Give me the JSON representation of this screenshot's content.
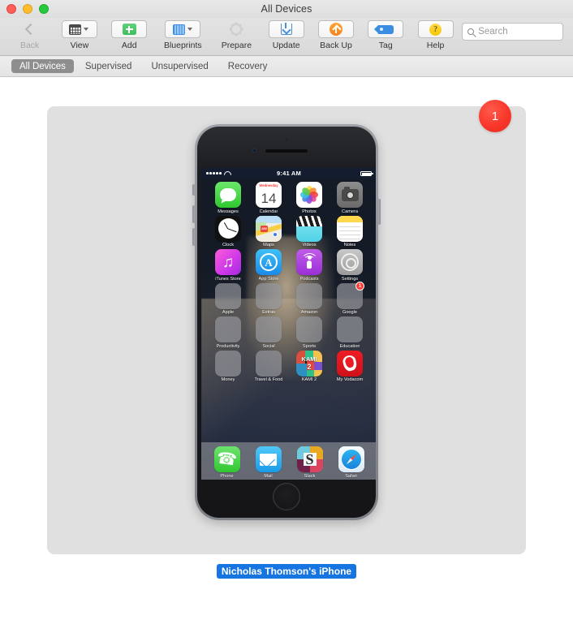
{
  "window": {
    "title": "All Devices",
    "traffic_lights": [
      "close",
      "minimize",
      "maximize"
    ]
  },
  "toolbar": {
    "items": [
      {
        "label": "Back",
        "icon": "back-chevron-icon",
        "enabled": false,
        "has_menu": false
      },
      {
        "label": "View",
        "icon": "grid-view-icon",
        "enabled": true,
        "has_menu": true
      },
      {
        "label": "Add",
        "icon": "plus-icon",
        "enabled": true,
        "has_menu": false
      },
      {
        "label": "Blueprints",
        "icon": "blueprint-grid-icon",
        "enabled": true,
        "has_menu": true
      },
      {
        "label": "Prepare",
        "icon": "gear-icon",
        "enabled": false,
        "has_menu": false
      },
      {
        "label": "Update",
        "icon": "download-icon",
        "enabled": true,
        "has_menu": false
      },
      {
        "label": "Back Up",
        "icon": "up-arrow-circle-icon",
        "enabled": true,
        "has_menu": false
      },
      {
        "label": "Tag",
        "icon": "tag-icon",
        "enabled": true,
        "has_menu": false
      },
      {
        "label": "Help",
        "icon": "question-circle-icon",
        "enabled": true,
        "has_menu": false
      }
    ],
    "search": {
      "placeholder": "Search",
      "value": "",
      "icon": "search-icon"
    }
  },
  "tabs": [
    {
      "label": "All Devices",
      "active": true
    },
    {
      "label": "Supervised",
      "active": false
    },
    {
      "label": "Unsupervised",
      "active": false
    },
    {
      "label": "Recovery",
      "active": false
    }
  ],
  "device_card": {
    "badge": "1",
    "device_name": "Nicholas Thomson's iPhone",
    "selected": true,
    "device_type": "iPhone",
    "device_color": "Space Gray"
  },
  "phone_screen": {
    "status_bar": {
      "signal_dots": 5,
      "wifi": "wifi-icon",
      "time": "9:41 AM",
      "battery": "battery-full-icon"
    },
    "calendar_weekday": "Wednesday",
    "calendar_day": "14",
    "home_rows": [
      [
        {
          "name": "Messages",
          "kind": "app",
          "badge": null
        },
        {
          "name": "Calendar",
          "kind": "app",
          "badge": null
        },
        {
          "name": "Photos",
          "kind": "app",
          "badge": null
        },
        {
          "name": "Camera",
          "kind": "app",
          "badge": null
        }
      ],
      [
        {
          "name": "Clock",
          "kind": "app",
          "badge": null
        },
        {
          "name": "Maps",
          "kind": "app",
          "badge": null
        },
        {
          "name": "Videos",
          "kind": "app",
          "badge": null
        },
        {
          "name": "Notes",
          "kind": "app",
          "badge": null
        }
      ],
      [
        {
          "name": "iTunes Store",
          "kind": "app",
          "badge": null
        },
        {
          "name": "App Store",
          "kind": "app",
          "badge": null
        },
        {
          "name": "Podcasts",
          "kind": "app",
          "badge": null
        },
        {
          "name": "Settings",
          "kind": "app",
          "badge": null
        }
      ],
      [
        {
          "name": "Apple",
          "kind": "folder",
          "badge": null
        },
        {
          "name": "Extras",
          "kind": "folder",
          "badge": null
        },
        {
          "name": "Amazon",
          "kind": "folder",
          "badge": null
        },
        {
          "name": "Google",
          "kind": "folder",
          "badge": "1"
        }
      ],
      [
        {
          "name": "Productivity",
          "kind": "folder",
          "badge": null
        },
        {
          "name": "Social",
          "kind": "folder",
          "badge": null
        },
        {
          "name": "Sports",
          "kind": "folder",
          "badge": null
        },
        {
          "name": "Education",
          "kind": "folder",
          "badge": null
        }
      ],
      [
        {
          "name": "Money",
          "kind": "folder",
          "badge": null
        },
        {
          "name": "Travel & Food",
          "kind": "folder",
          "badge": null
        },
        {
          "name": "KAMI 2",
          "kind": "app",
          "badge": null
        },
        {
          "name": "My Vodacom",
          "kind": "app",
          "badge": null
        }
      ]
    ],
    "dock": [
      {
        "name": "Phone",
        "badge": null
      },
      {
        "name": "Mail",
        "badge": null
      },
      {
        "name": "Slack",
        "badge": null
      },
      {
        "name": "Safari",
        "badge": null
      }
    ],
    "slack_letter": "S",
    "appstore_letter": "A",
    "kami_title": "KAMI",
    "kami_num": "2",
    "maps_shield": "280"
  },
  "colors": {
    "accent_blue": "#1675e0",
    "badge_red": "#f8372a",
    "card_bg": "#e0e0e0",
    "toolbar_bg": "#dedede",
    "tab_active_bg": "#8e8e8e"
  }
}
